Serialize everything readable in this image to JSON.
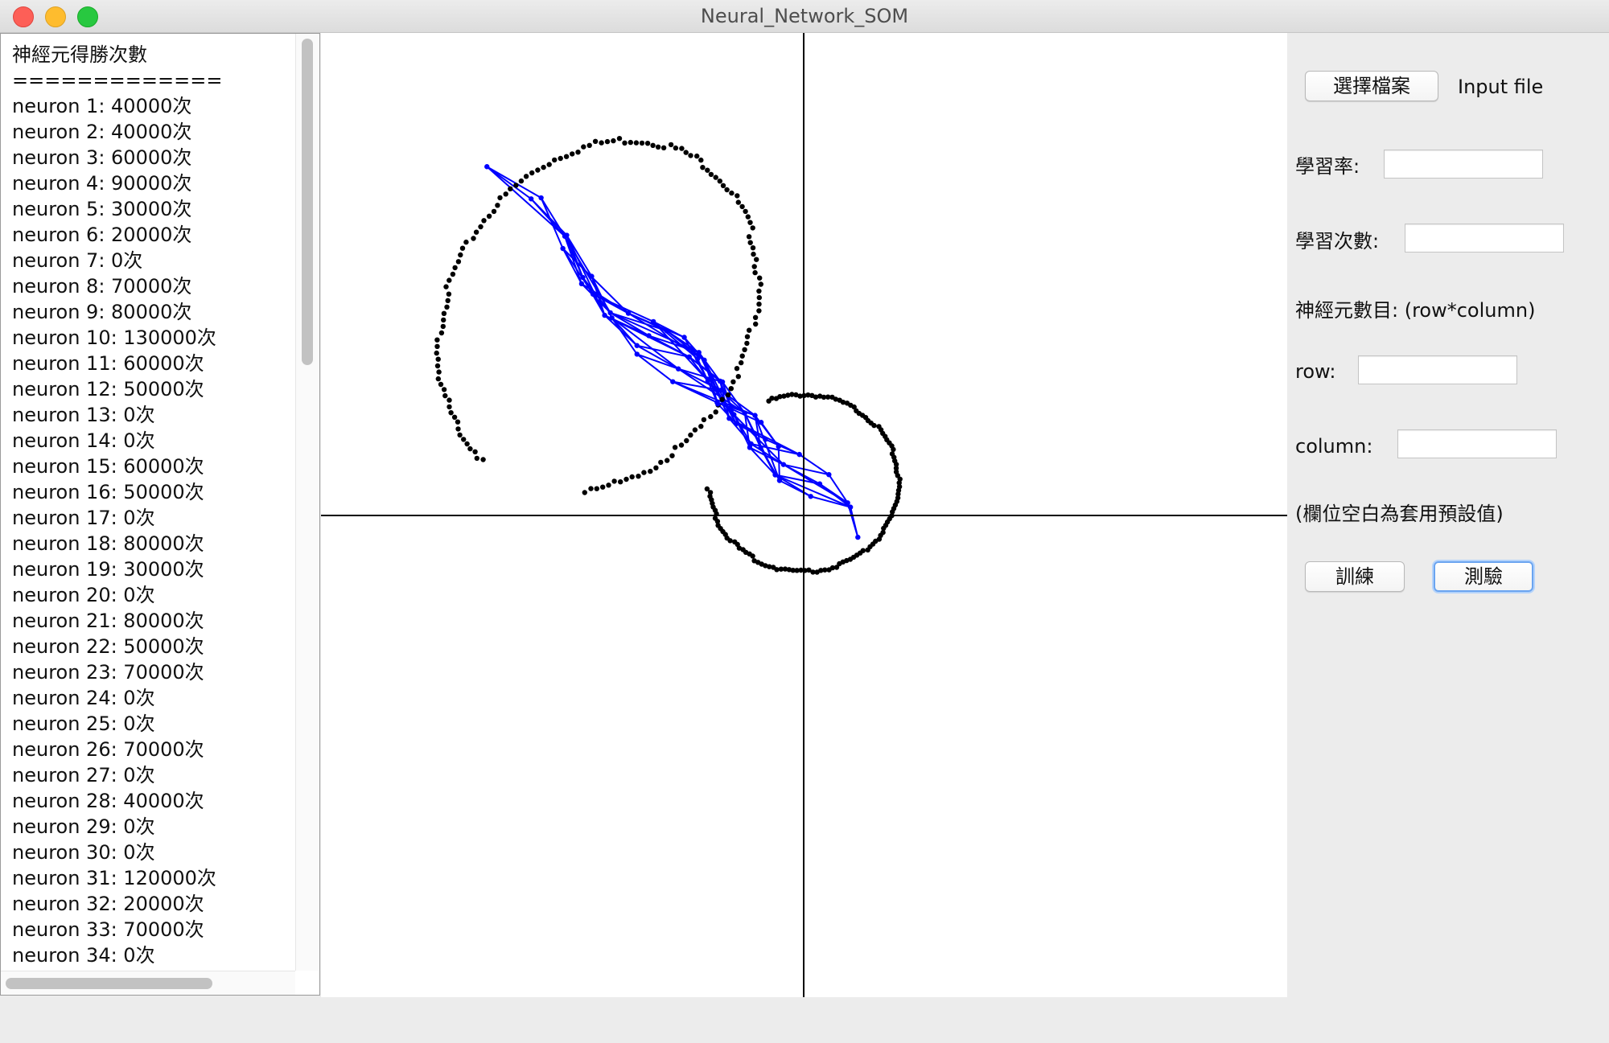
{
  "window": {
    "title": "Neural_Network_SOM"
  },
  "log": {
    "header": "神經元得勝次數",
    "divider": "=============",
    "lines": [
      "neuron 1: 40000次",
      "neuron 2: 40000次",
      "neuron 3: 60000次",
      "neuron 4: 90000次",
      "neuron 5: 30000次",
      "neuron 6: 20000次",
      "neuron 7: 0次",
      "neuron 8: 70000次",
      "neuron 9: 80000次",
      "neuron 10: 130000次",
      "neuron 11: 60000次",
      "neuron 12: 50000次",
      "neuron 13: 0次",
      "neuron 14: 0次",
      "neuron 15: 60000次",
      "neuron 16: 50000次",
      "neuron 17: 0次",
      "neuron 18: 80000次",
      "neuron 19: 30000次",
      "neuron 20: 0次",
      "neuron 21: 80000次",
      "neuron 22: 50000次",
      "neuron 23: 70000次",
      "neuron 24: 0次",
      "neuron 25: 0次",
      "neuron 26: 70000次",
      "neuron 27: 0次",
      "neuron 28: 40000次",
      "neuron 29: 0次",
      "neuron 30: 0次",
      "neuron 31: 120000次",
      "neuron 32: 20000次",
      "neuron 33: 70000次",
      "neuron 34: 0次"
    ]
  },
  "controls": {
    "choose_file_button": "選擇檔案",
    "input_file_label": "Input file",
    "learning_rate_label": "學習率:",
    "learning_rate_value": "",
    "iterations_label": "學習次數:",
    "iterations_value": "",
    "neuron_count_label": "神經元數目: (row*column)",
    "row_label": "row:",
    "row_value": "",
    "column_label": "column:",
    "column_value": "",
    "default_hint": "(欄位空白為套用預設值)",
    "train_button": "訓練",
    "test_button": "測驗"
  },
  "plot": {
    "colors": {
      "axes": "#000000",
      "data_points": "#000000",
      "grid": "#0000ff"
    }
  }
}
